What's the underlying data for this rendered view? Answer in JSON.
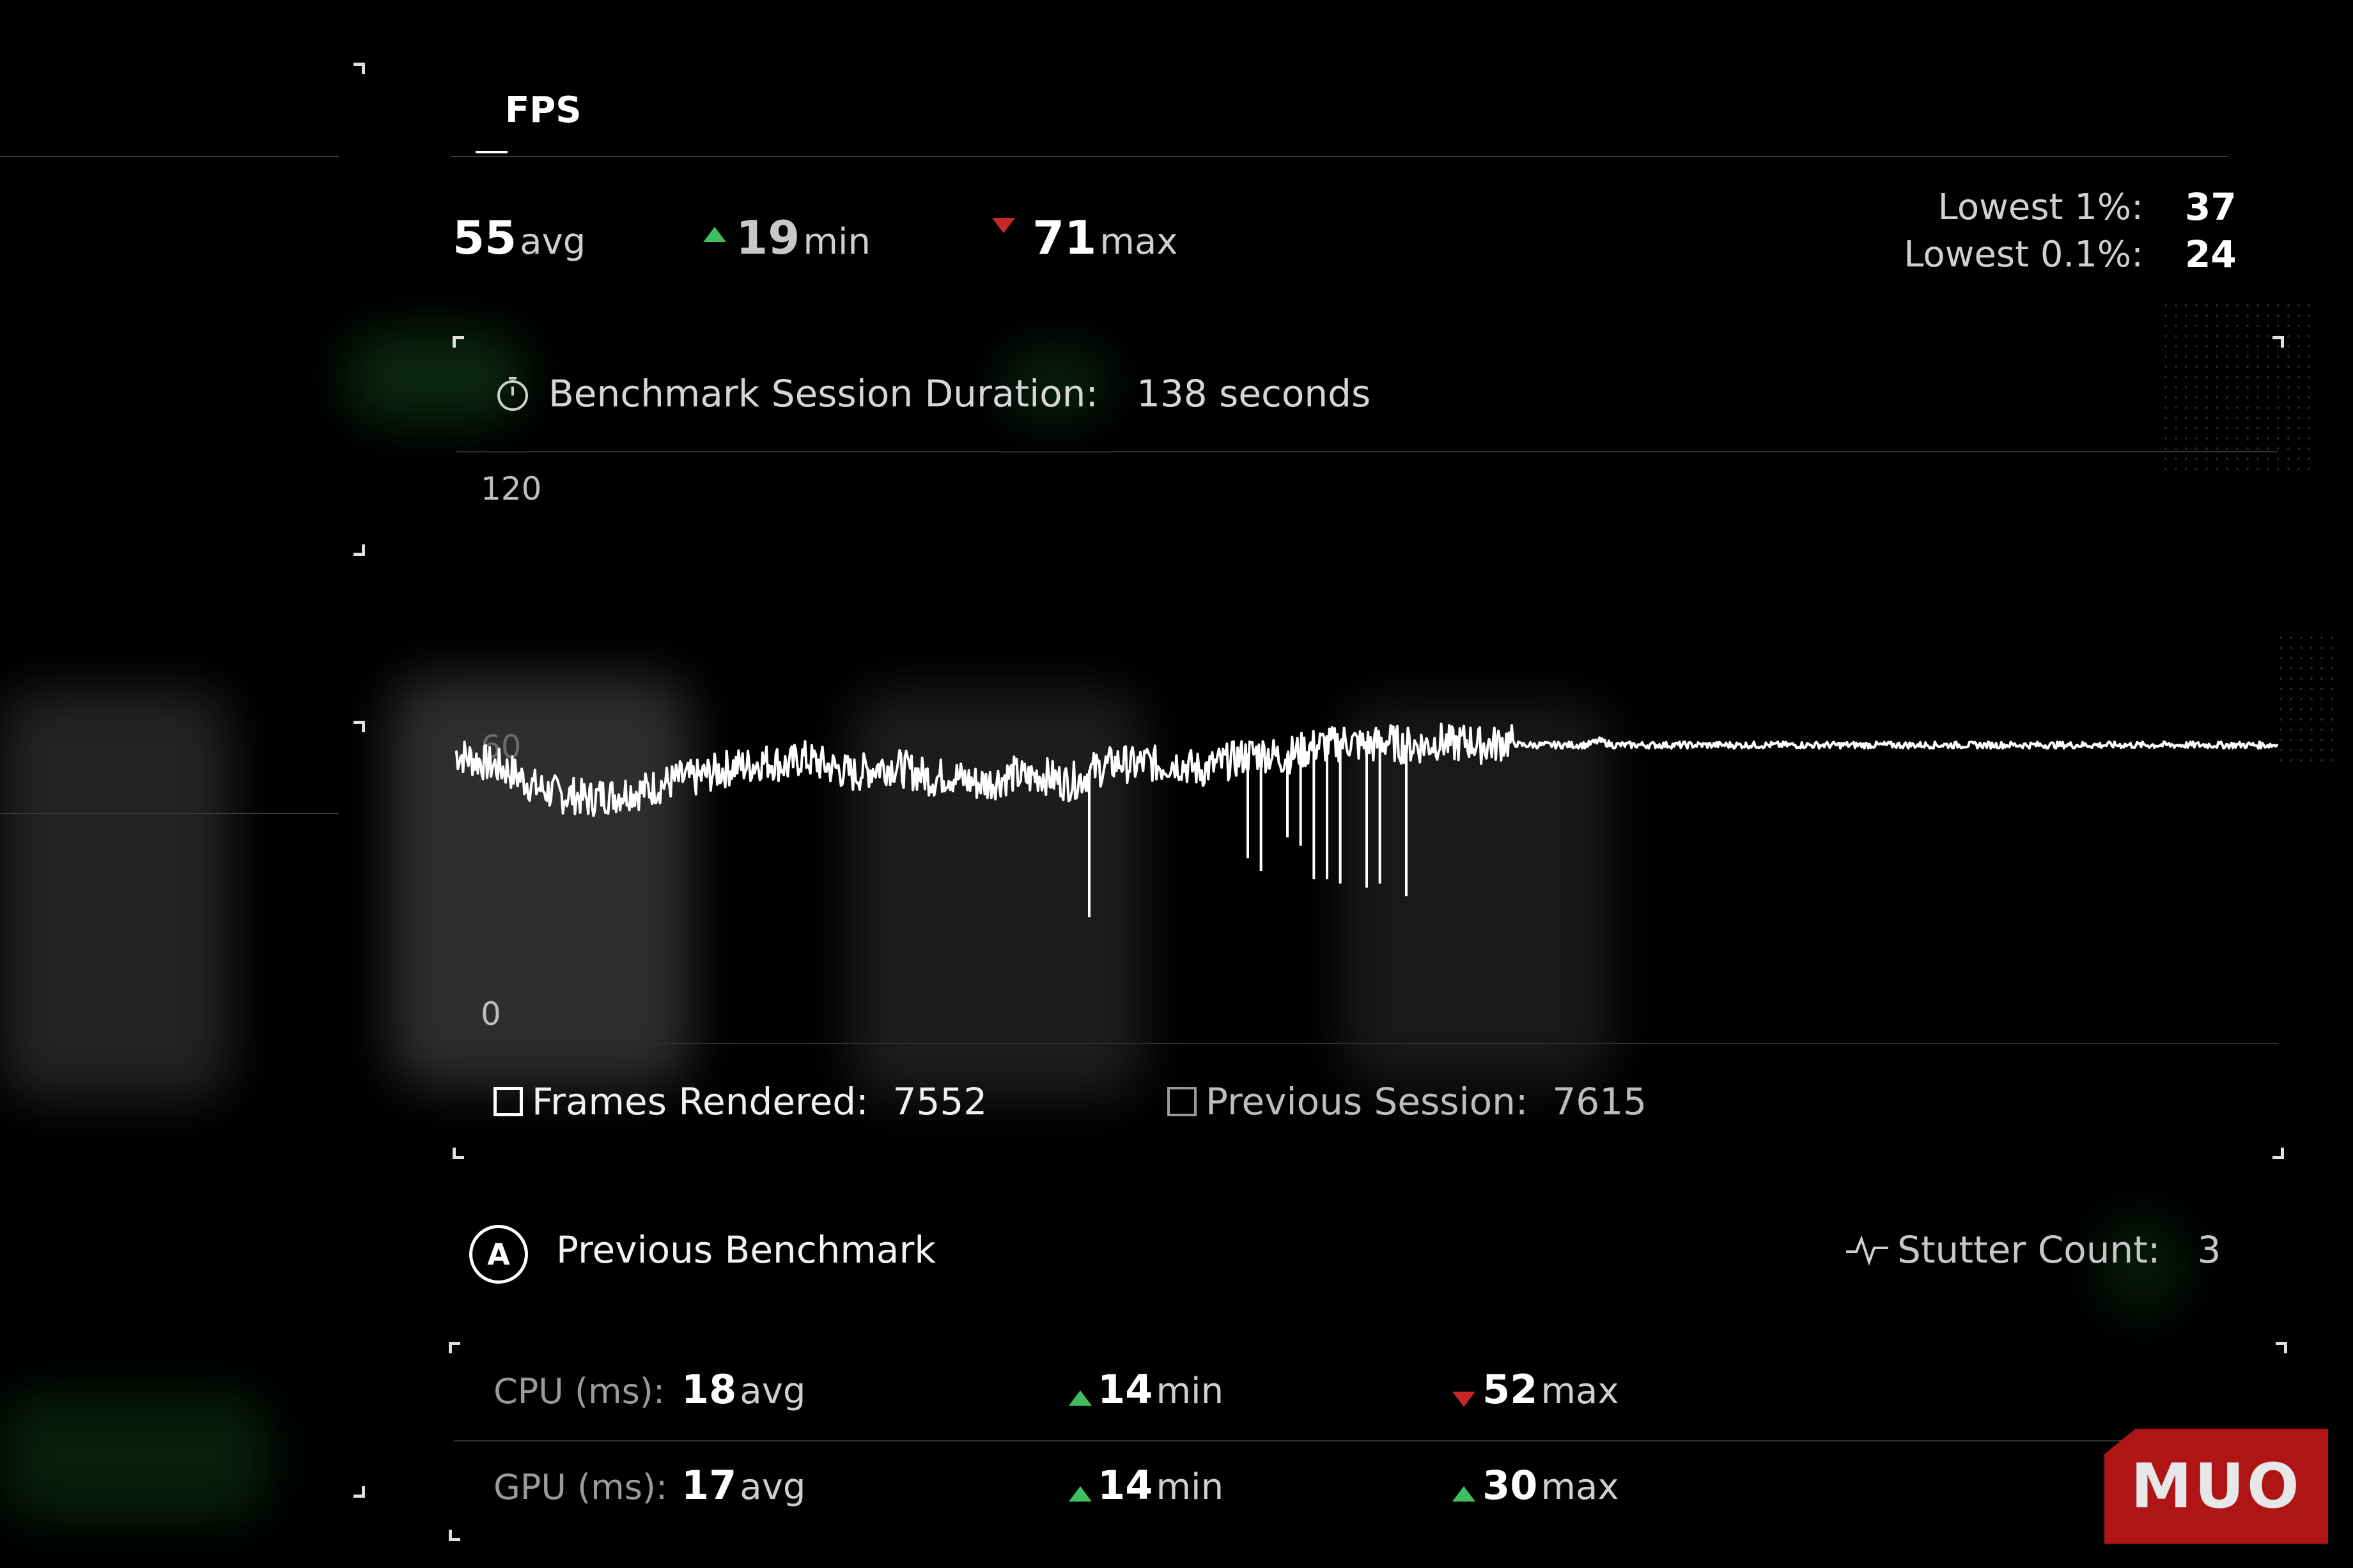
{
  "header": {
    "tab_label": "FPS"
  },
  "fps": {
    "avg_value": "55",
    "avg_unit": "avg",
    "min_value": "19",
    "min_unit": "min",
    "max_value": "71",
    "max_unit": "max",
    "lowest_1_label": "Lowest 1%:",
    "lowest_1_value": "37",
    "lowest_01_label": "Lowest 0.1%:",
    "lowest_01_value": "24"
  },
  "session": {
    "duration_label": "Benchmark Session Duration:",
    "duration_value": "138 seconds",
    "frames_label": "Frames Rendered:",
    "frames_value": "7552",
    "previous_label": "Previous Session:",
    "previous_value": "7615"
  },
  "previous_benchmark": {
    "button_glyph": "A",
    "label": "Previous Benchmark",
    "stutter_label": "Stutter Count:",
    "stutter_value": "3"
  },
  "cpu": {
    "label": "CPU (ms):",
    "avg_value": "18",
    "avg_unit": "avg",
    "min_value": "14",
    "min_unit": "min",
    "max_value": "52",
    "max_unit": "max"
  },
  "gpu": {
    "label": "GPU (ms):",
    "avg_value": "17",
    "avg_unit": "avg",
    "min_value": "14",
    "min_unit": "min",
    "max_value": "30",
    "max_unit": "max"
  },
  "watermark": "MUO",
  "colors": {
    "up": "#3fbf5f",
    "down": "#c62828",
    "line": "#ffffff",
    "logo": "#b01515"
  },
  "chart_data": {
    "type": "line",
    "x_range": [
      0,
      138
    ],
    "ylim": [
      0,
      120
    ],
    "y_ticks": [
      "120",
      "60",
      "0"
    ],
    "grid": false,
    "series": [
      {
        "values": [
          58,
          57,
          56,
          55,
          54,
          52,
          50,
          49,
          48,
          48,
          47,
          48,
          48,
          49,
          49,
          50,
          51,
          52,
          52,
          53,
          54,
          55,
          55,
          56,
          56,
          55,
          57,
          56,
          55,
          54,
          53,
          54,
          55,
          55,
          54,
          53,
          52,
          53,
          52,
          51,
          51,
          52,
          53,
          52,
          53,
          52,
          51,
          52,
          54,
          55,
          56,
          55,
          56,
          55,
          56,
          55,
          54,
          55,
          56,
          57,
          58,
          58,
          57,
          58,
          59,
          60,
          60,
          61,
          60,
          60,
          61,
          60,
          60,
          60,
          61,
          60,
          61,
          60,
          60,
          61,
          60,
          60,
          60,
          60,
          60,
          60,
          61,
          60,
          60,
          60,
          60,
          60,
          60,
          60,
          60,
          60,
          60,
          60,
          60,
          60,
          60,
          60,
          60,
          60,
          60,
          60,
          60,
          60,
          60,
          60,
          60,
          60,
          60,
          60,
          60,
          60,
          60,
          60,
          60,
          60,
          60,
          60,
          60,
          60,
          60,
          60,
          60,
          60,
          60,
          60,
          60,
          60,
          60,
          60,
          60,
          60,
          60,
          60
        ]
      }
    ],
    "dips": [
      {
        "x": 48,
        "y": 19
      },
      {
        "x": 60,
        "y": 33
      },
      {
        "x": 61,
        "y": 30
      },
      {
        "x": 63,
        "y": 38
      },
      {
        "x": 64,
        "y": 36
      },
      {
        "x": 65,
        "y": 28
      },
      {
        "x": 66,
        "y": 28
      },
      {
        "x": 67,
        "y": 27
      },
      {
        "x": 69,
        "y": 26
      },
      {
        "x": 70,
        "y": 27
      },
      {
        "x": 72,
        "y": 24
      }
    ]
  }
}
